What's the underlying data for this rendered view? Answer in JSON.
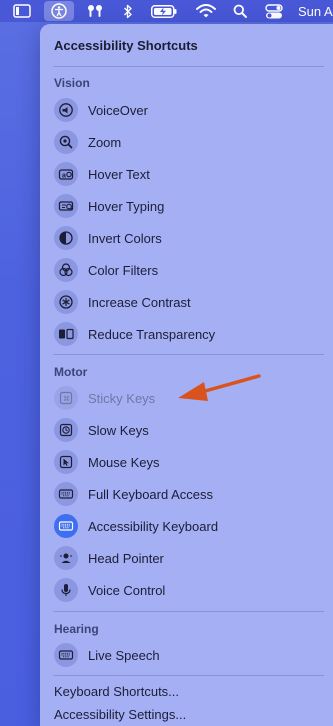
{
  "menubar": {
    "clock": "Sun A"
  },
  "menu": {
    "title": "Accessibility Shortcuts",
    "sections": {
      "vision": "Vision",
      "motor": "Motor",
      "hearing": "Hearing"
    },
    "vision_items": [
      {
        "label": "VoiceOver",
        "icon": "voiceover-icon"
      },
      {
        "label": "Zoom",
        "icon": "zoom-icon"
      },
      {
        "label": "Hover Text",
        "icon": "hover-text-icon"
      },
      {
        "label": "Hover Typing",
        "icon": "hover-typing-icon"
      },
      {
        "label": "Invert Colors",
        "icon": "invert-colors-icon"
      },
      {
        "label": "Color Filters",
        "icon": "color-filters-icon"
      },
      {
        "label": "Increase Contrast",
        "icon": "increase-contrast-icon"
      },
      {
        "label": "Reduce Transparency",
        "icon": "reduce-transparency-icon"
      }
    ],
    "motor_items": [
      {
        "label": "Sticky Keys",
        "icon": "sticky-keys-icon",
        "enabled": false
      },
      {
        "label": "Slow Keys",
        "icon": "slow-keys-icon"
      },
      {
        "label": "Mouse Keys",
        "icon": "mouse-keys-icon"
      },
      {
        "label": "Full Keyboard Access",
        "icon": "keyboard-icon"
      },
      {
        "label": "Accessibility Keyboard",
        "icon": "keyboard-icon",
        "active": true
      },
      {
        "label": "Head Pointer",
        "icon": "head-pointer-icon"
      },
      {
        "label": "Voice Control",
        "icon": "microphone-icon"
      }
    ],
    "hearing_items": [
      {
        "label": "Live Speech",
        "icon": "keyboard-icon"
      }
    ],
    "footer": {
      "keyboard_shortcuts": "Keyboard Shortcuts...",
      "accessibility_settings": "Accessibility Settings..."
    }
  },
  "colors": {
    "accent": "#3f6ff0",
    "annotation_arrow": "#d9531e"
  }
}
